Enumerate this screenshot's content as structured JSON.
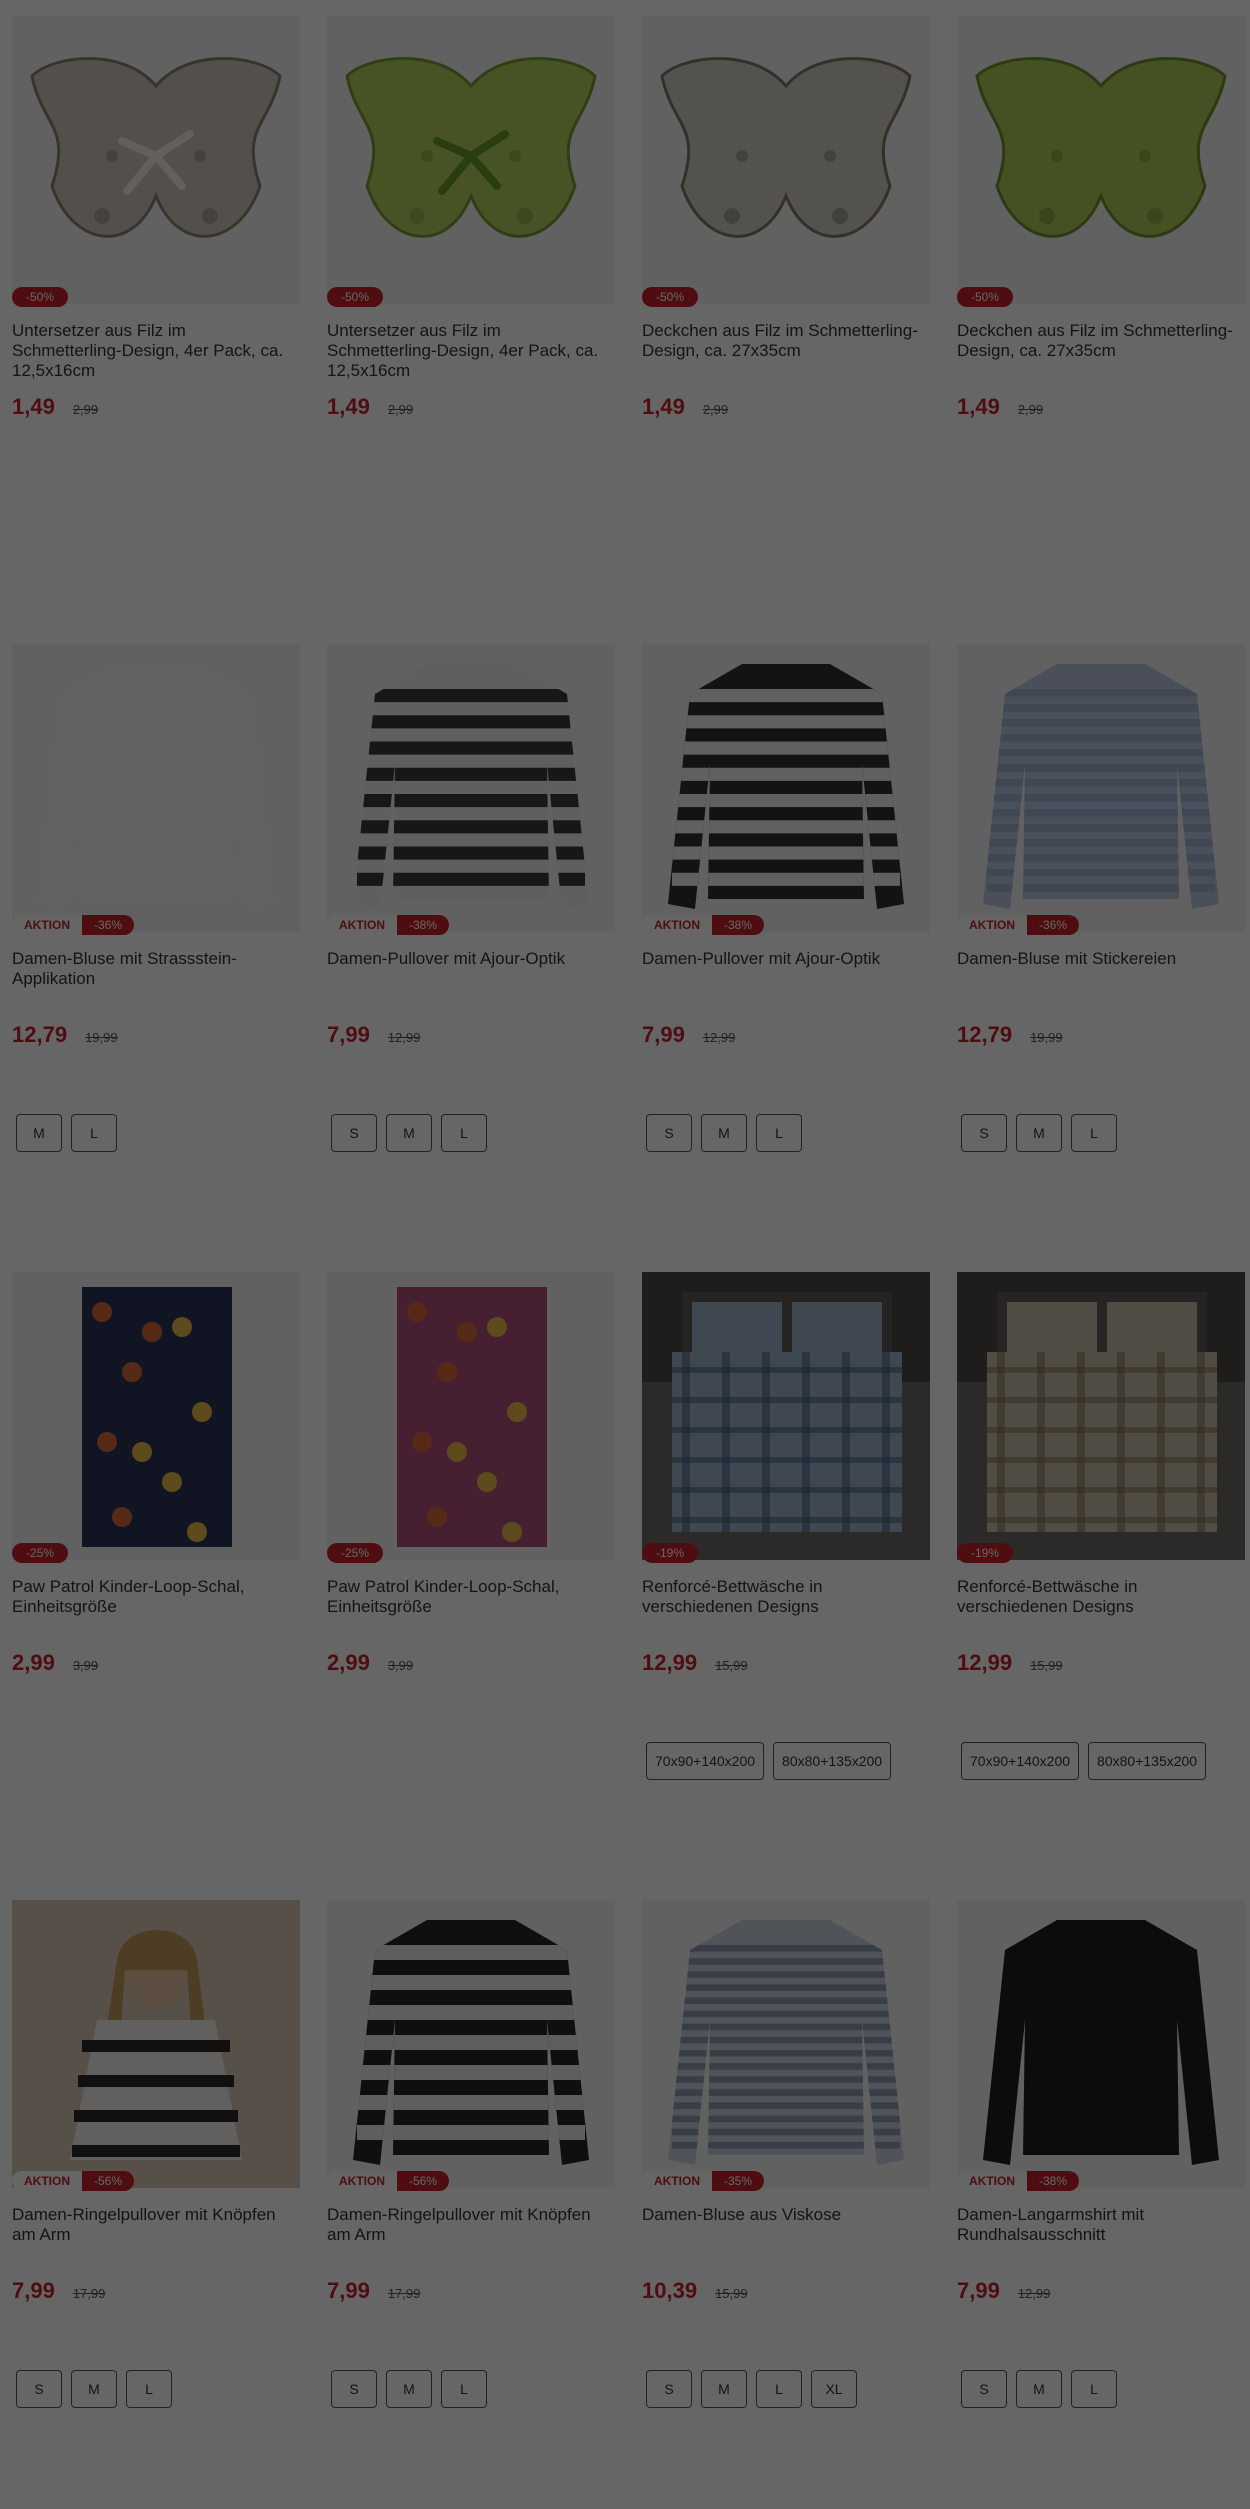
{
  "colors": {
    "accent": "#c8222b",
    "overlay": "rgba(0,0,0,0.6)"
  },
  "products": [
    {
      "title": "Untersetzer aus Filz im Schmetterling-Design, 4er Pack, ca. 12,5x16cm",
      "price": "1,49",
      "old": "2,99",
      "discount": "-50%",
      "aktion": "",
      "sizes": [],
      "image": "butterfly-grey-bow"
    },
    {
      "title": "Untersetzer aus Filz im Schmetterling-Design, 4er Pack, ca. 12,5x16cm",
      "price": "1,49",
      "old": "2,99",
      "discount": "-50%",
      "aktion": "",
      "sizes": [],
      "image": "butterfly-green-bow"
    },
    {
      "title": "Deckchen aus Filz im Schmetterling-Design, ca. 27x35cm",
      "price": "1,49",
      "old": "2,99",
      "discount": "-50%",
      "aktion": "",
      "sizes": [],
      "image": "butterfly-grey"
    },
    {
      "title": "Deckchen aus Filz im Schmetterling-Design, ca. 27x35cm",
      "price": "1,49",
      "old": "2,99",
      "discount": "-50%",
      "aktion": "",
      "sizes": [],
      "image": "butterfly-green"
    },
    {
      "title": "Damen-Bluse mit Strassstein-Applikation",
      "price": "12,79",
      "old": "19,99",
      "discount": "-36%",
      "aktion": "AKTION",
      "sizes": [
        "M",
        "L"
      ],
      "image": "white-blouse"
    },
    {
      "title": "Damen-Pullover mit Ajour-Optik",
      "price": "7,99",
      "old": "12,99",
      "discount": "-38%",
      "aktion": "AKTION",
      "sizes": [
        "S",
        "M",
        "L"
      ],
      "image": "striped-light"
    },
    {
      "title": "Damen-Pullover mit Ajour-Optik",
      "price": "7,99",
      "old": "12,99",
      "discount": "-38%",
      "aktion": "AKTION",
      "sizes": [
        "S",
        "M",
        "L"
      ],
      "image": "striped-dark"
    },
    {
      "title": "Damen-Bluse mit Stickereien",
      "price": "12,79",
      "old": "19,99",
      "discount": "-36%",
      "aktion": "AKTION",
      "sizes": [
        "S",
        "M",
        "L"
      ],
      "image": "blue-blouse"
    },
    {
      "title": "Paw Patrol Kinder-Loop-Schal, Einheitsgröße",
      "price": "2,99",
      "old": "3,99",
      "discount": "-25%",
      "aktion": "",
      "sizes": [],
      "image": "scarf-navy"
    },
    {
      "title": "Paw Patrol Kinder-Loop-Schal, Einheitsgröße",
      "price": "2,99",
      "old": "3,99",
      "discount": "-25%",
      "aktion": "",
      "sizes": [],
      "image": "scarf-pink"
    },
    {
      "title": "Renforcé-Bettwäsche in verschiedenen Designs",
      "price": "12,99",
      "old": "15,99",
      "discount": "-19%",
      "aktion": "",
      "sizes": [
        "70x90+140x200",
        "80x80+135x200"
      ],
      "image": "bed-plaid"
    },
    {
      "title": "Renforcé-Bettwäsche in verschiedenen Designs",
      "price": "12,99",
      "old": "15,99",
      "discount": "-19%",
      "aktion": "",
      "sizes": [
        "70x90+140x200",
        "80x80+135x200"
      ],
      "image": "bed-floral"
    },
    {
      "title": "Damen-Ringelpullover mit Knöpfen am Arm",
      "price": "7,99",
      "old": "17,99",
      "discount": "-56%",
      "aktion": "AKTION",
      "sizes": [
        "S",
        "M",
        "L"
      ],
      "image": "model-striped"
    },
    {
      "title": "Damen-Ringelpullover mit Knöpfen am Arm",
      "price": "7,99",
      "old": "17,99",
      "discount": "-56%",
      "aktion": "AKTION",
      "sizes": [
        "S",
        "M",
        "L"
      ],
      "image": "striped-dark-2"
    },
    {
      "title": "Damen-Bluse aus Viskose",
      "price": "10,39",
      "old": "15,99",
      "discount": "-35%",
      "aktion": "AKTION",
      "sizes": [
        "S",
        "M",
        "L",
        "XL"
      ],
      "image": "striped-blouse"
    },
    {
      "title": "Damen-Langarmshirt mit Rundhalsausschnitt",
      "price": "7,99",
      "old": "12,99",
      "discount": "-38%",
      "aktion": "AKTION",
      "sizes": [
        "S",
        "M",
        "L"
      ],
      "image": "black-shirt"
    }
  ]
}
